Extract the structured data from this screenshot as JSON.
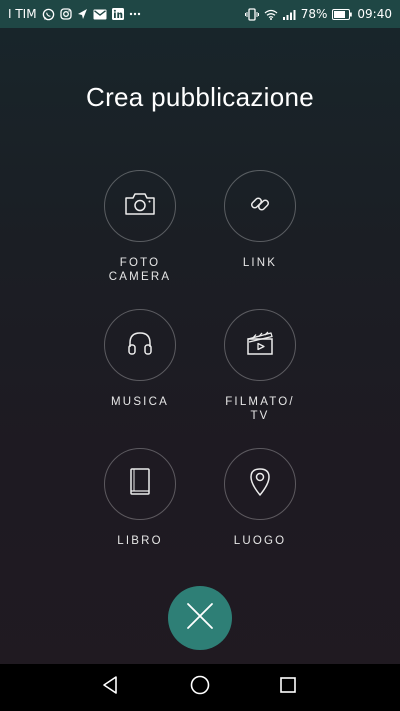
{
  "status_bar": {
    "carrier": "I TIM",
    "battery_percent": "78%",
    "time": "09:40",
    "left_icons": [
      "whatsapp-icon",
      "instagram-icon",
      "navigation-icon",
      "mail-icon",
      "linkedin-icon",
      "more-dots-icon"
    ],
    "right_icons": [
      "vibrate-icon",
      "wifi-icon",
      "signal-icon",
      "battery-icon"
    ]
  },
  "screen": {
    "title": "Crea pubblicazione"
  },
  "options": [
    {
      "label": "FOTO\nCAMERA",
      "icon": "camera-icon"
    },
    {
      "label": "LINK",
      "icon": "link-icon"
    },
    {
      "label": "MUSICA",
      "icon": "headphones-icon"
    },
    {
      "label": "FILMATO/\nTV",
      "icon": "clapperboard-icon"
    },
    {
      "label": "LIBRO",
      "icon": "book-icon"
    },
    {
      "label": "LUOGO",
      "icon": "location-pin-icon"
    }
  ],
  "close_button": {
    "icon": "close-icon"
  },
  "nav_bar": {
    "icons": [
      "back-icon",
      "home-icon",
      "recents-icon"
    ]
  },
  "colors": {
    "status_bar": "#1f4745",
    "accent": "#2e7f76",
    "background_top": "#18262b",
    "background_bottom": "#201a21",
    "nav_bar": "#000000"
  }
}
